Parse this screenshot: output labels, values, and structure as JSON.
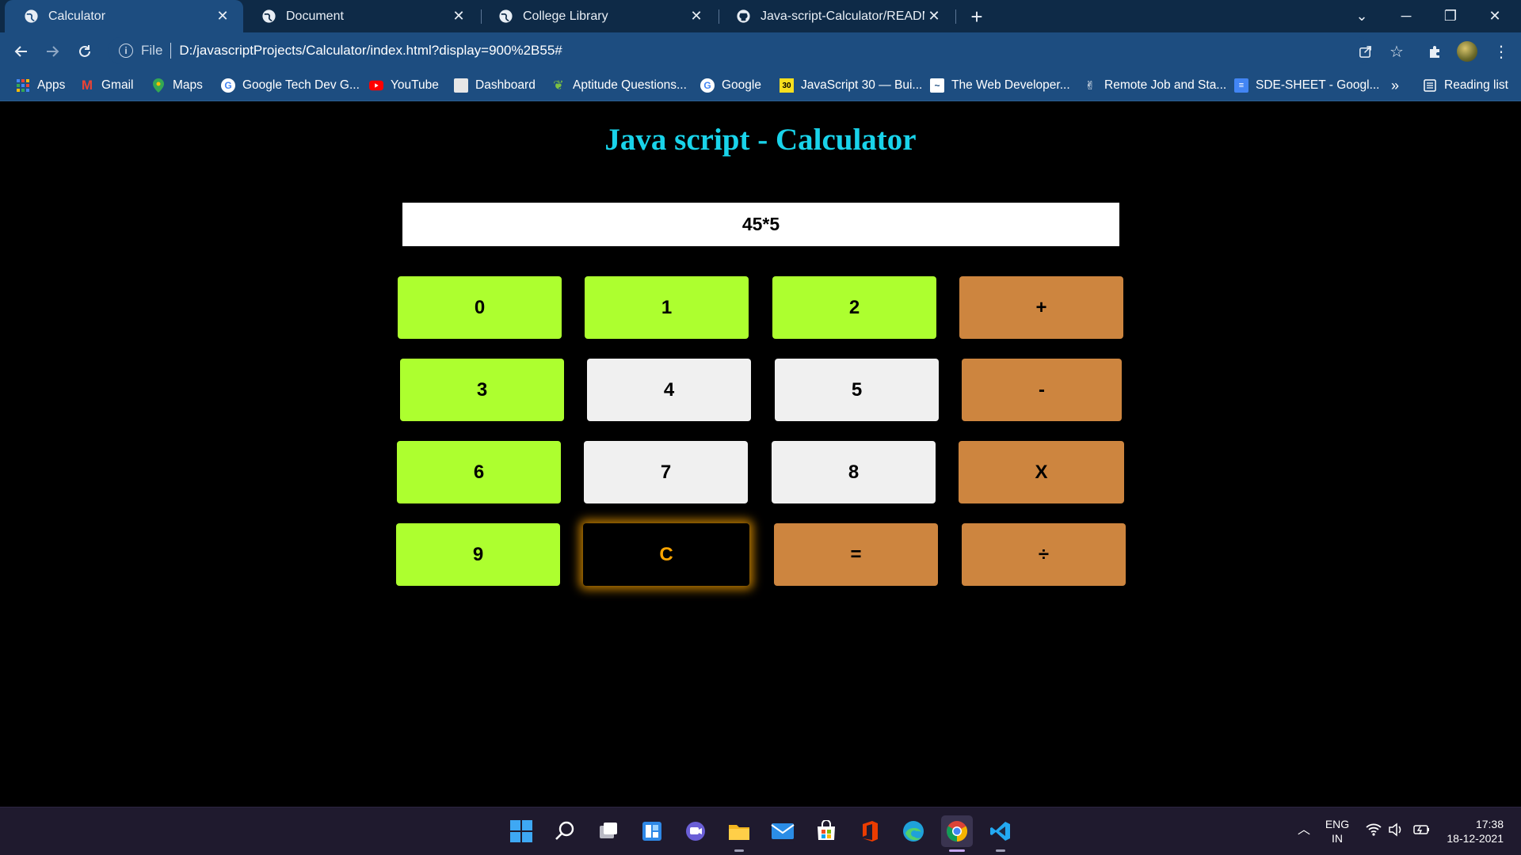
{
  "browser": {
    "tabs": [
      {
        "title": "Calculator",
        "icon": "globe-icon",
        "active": true
      },
      {
        "title": "Document",
        "icon": "globe-icon",
        "active": false
      },
      {
        "title": "College Library",
        "icon": "globe-icon",
        "active": false
      },
      {
        "title": "Java-script-Calculator/README.m",
        "icon": "github-icon",
        "active": false
      }
    ],
    "address": {
      "scheme_label": "File",
      "url": "D:/javascriptProjects/Calculator/index.html?display=900%2B55#"
    },
    "bookmarks": [
      {
        "label": "Apps",
        "icon": "apps-grid-icon"
      },
      {
        "label": "Gmail",
        "icon": "gmail-icon"
      },
      {
        "label": "Maps",
        "icon": "maps-pin-icon"
      },
      {
        "label": "Google Tech Dev G...",
        "icon": "google-icon"
      },
      {
        "label": "YouTube",
        "icon": "youtube-icon"
      },
      {
        "label": "Dashboard",
        "icon": "dashboard-icon"
      },
      {
        "label": "Aptitude Questions...",
        "icon": "leaf-icon"
      },
      {
        "label": "Google",
        "icon": "google-icon"
      },
      {
        "label": "JavaScript 30 — Bui...",
        "icon": "js30-icon"
      },
      {
        "label": "The Web Developer...",
        "icon": "webdev-icon"
      },
      {
        "label": "Remote Job and Sta...",
        "icon": "hand-icon"
      },
      {
        "label": "SDE-SHEET - Googl...",
        "icon": "docs-icon"
      }
    ],
    "more_bookmarks": "»",
    "reading_list": "Reading list",
    "tab_icon_glyph": "🌐",
    "github_glyph": "●"
  },
  "page": {
    "heading": "Java script - Calculator",
    "display_value": "45*5",
    "keys": [
      {
        "label": "0",
        "style": "green"
      },
      {
        "label": "1",
        "style": "green"
      },
      {
        "label": "2",
        "style": "green"
      },
      {
        "label": "+",
        "style": "orange"
      },
      {
        "label": "3",
        "style": "green"
      },
      {
        "label": "4",
        "style": "grey"
      },
      {
        "label": "5",
        "style": "grey"
      },
      {
        "label": "-",
        "style": "orange"
      },
      {
        "label": "6",
        "style": "green"
      },
      {
        "label": "7",
        "style": "grey"
      },
      {
        "label": "8",
        "style": "grey"
      },
      {
        "label": "X",
        "style": "orange"
      },
      {
        "label": "9",
        "style": "green"
      },
      {
        "label": "C",
        "style": "clear"
      },
      {
        "label": "=",
        "style": "orange"
      },
      {
        "label": "÷",
        "style": "orange"
      }
    ],
    "colors": {
      "heading": "#19d3ea",
      "digit_green": "#adff2f",
      "digit_grey": "#f0f0f0",
      "operator": "#cd853f",
      "clear_text": "#ffa500"
    }
  },
  "taskbar": {
    "apps": [
      {
        "name": "start-icon"
      },
      {
        "name": "search-icon"
      },
      {
        "name": "task-view-icon"
      },
      {
        "name": "widgets-icon"
      },
      {
        "name": "teams-chat-icon"
      },
      {
        "name": "file-explorer-icon"
      },
      {
        "name": "mail-icon"
      },
      {
        "name": "store-icon"
      },
      {
        "name": "office-icon"
      },
      {
        "name": "edge-icon"
      },
      {
        "name": "chrome-icon"
      },
      {
        "name": "vscode-icon"
      }
    ],
    "language": "ENG",
    "region": "IN",
    "time": "17:38",
    "date": "18-12-2021"
  }
}
